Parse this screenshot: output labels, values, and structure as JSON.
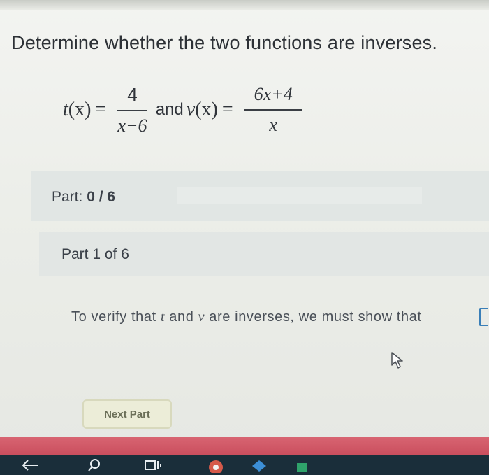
{
  "question": {
    "title": "Determine whether the two functions are inverses."
  },
  "functions": {
    "f1_name": "t",
    "f1_arg": "(x)",
    "f1_equals": "=",
    "f1_numerator": "4",
    "f1_denominator": "x−6",
    "conjunction": "and",
    "f2_name": "v",
    "f2_arg": "(x)",
    "f2_equals": "=",
    "f2_numerator": "6x+4",
    "f2_denominator": "x"
  },
  "progress": {
    "label": "Part:",
    "value": "0 / 6"
  },
  "subpart": {
    "label": "Part 1 of 6"
  },
  "instruction": {
    "prefix": "To verify that",
    "var1": "t",
    "middle": "and",
    "var2": "v",
    "suffix": "are inverses, we must show that"
  },
  "actions": {
    "next_label": "Next Part"
  },
  "colors": {
    "accent_strip": "#c84b5b",
    "taskbar": "#1a2e3a",
    "button_bg": "#ecedd8"
  },
  "icons": {
    "cursor": "pointer-arrow-icon",
    "back": "back-arrow-icon",
    "search": "search-icon",
    "task_view": "task-view-icon"
  }
}
